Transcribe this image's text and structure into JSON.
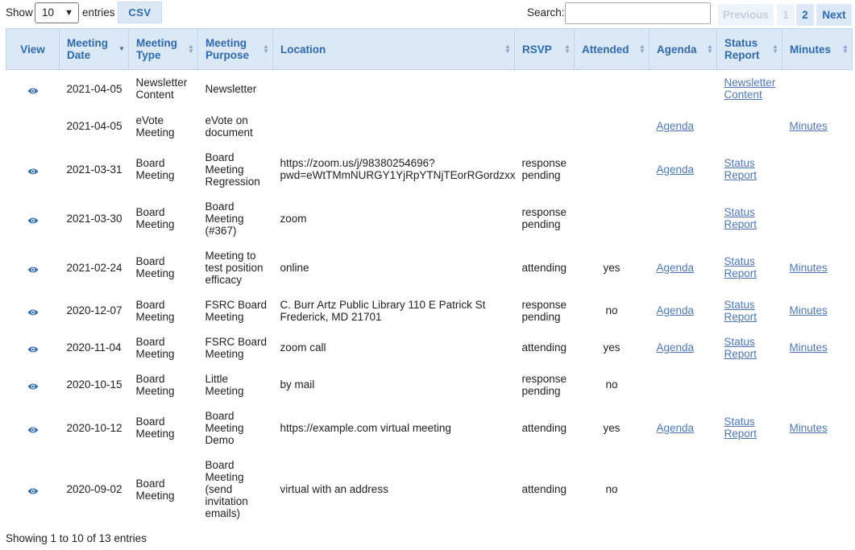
{
  "controls": {
    "show_label": "Show",
    "page_length": "10",
    "entries_label": "entries",
    "csv_label": "CSV",
    "search_label": "Search:",
    "search_value": ""
  },
  "pagination": {
    "previous": "Previous",
    "page1": "1",
    "page2": "2",
    "next": "Next"
  },
  "columns": {
    "view": "View",
    "meeting_date": [
      "Meeting",
      "Date"
    ],
    "meeting_type": [
      "Meeting",
      "Type"
    ],
    "meeting_purpose": [
      "Meeting",
      "Purpose"
    ],
    "location": "Location",
    "rsvp": "RSVP",
    "attended": "Attended",
    "agenda": "Agenda",
    "status_report": [
      "Status",
      "Report"
    ],
    "minutes": "Minutes"
  },
  "icons": {
    "view": "eye-icon",
    "sort": "sort-arrows-icon",
    "sort_desc": "sort-desc-icon",
    "dropdown": "chevron-down-icon"
  },
  "colors": {
    "accent": "#2e6ab0",
    "header_bg": "#dbe8f5",
    "link": "#4d78b5"
  },
  "rows": [
    {
      "has_view": true,
      "date": "2021-04-05",
      "type": [
        "Newsletter",
        "Content"
      ],
      "purpose": [
        "Newsletter"
      ],
      "location": [],
      "rsvp": [],
      "attended": "",
      "agenda": "",
      "status_report": [
        "Newsletter",
        "Content"
      ],
      "minutes": ""
    },
    {
      "has_view": false,
      "date": "2021-04-05",
      "type": [
        "eVote",
        "Meeting"
      ],
      "purpose": [
        "eVote on",
        "document"
      ],
      "location": [],
      "rsvp": [],
      "attended": "",
      "agenda": "Agenda",
      "status_report": [],
      "minutes": "Minutes"
    },
    {
      "has_view": true,
      "date": "2021-03-31",
      "type": [
        "Board",
        "Meeting"
      ],
      "purpose": [
        "Board",
        "Meeting",
        "Regression"
      ],
      "location": [
        "https://zoom.us/j/98380254696?",
        "pwd=eWtTMmNURGY1YjRpYTNjTEorRGordzxx"
      ],
      "rsvp": [
        "response",
        "pending"
      ],
      "attended": "",
      "agenda": "Agenda",
      "status_report": [
        "Status",
        "Report"
      ],
      "minutes": ""
    },
    {
      "has_view": true,
      "date": "2021-03-30",
      "type": [
        "Board",
        "Meeting"
      ],
      "purpose": [
        "Board",
        "Meeting",
        "(#367)"
      ],
      "location": [
        "zoom"
      ],
      "rsvp": [
        "response",
        "pending"
      ],
      "attended": "",
      "agenda": "",
      "status_report": [
        "Status",
        "Report"
      ],
      "minutes": ""
    },
    {
      "has_view": true,
      "date": "2021-02-24",
      "type": [
        "Board",
        "Meeting"
      ],
      "purpose": [
        "Meeting to",
        "test position",
        "efficacy"
      ],
      "location": [
        "online"
      ],
      "rsvp": [
        "attending"
      ],
      "attended": "yes",
      "agenda": "Agenda",
      "status_report": [
        "Status",
        "Report"
      ],
      "minutes": "Minutes"
    },
    {
      "has_view": true,
      "date": "2020-12-07",
      "type": [
        "Board",
        "Meeting"
      ],
      "purpose": [
        "FSRC Board",
        "Meeting"
      ],
      "location": [
        "C. Burr Artz Public Library 110 E Patrick St",
        "Frederick, MD 21701"
      ],
      "rsvp": [
        "response",
        "pending"
      ],
      "attended": "no",
      "agenda": "Agenda",
      "status_report": [
        "Status",
        "Report"
      ],
      "minutes": "Minutes"
    },
    {
      "has_view": true,
      "date": "2020-11-04",
      "type": [
        "Board",
        "Meeting"
      ],
      "purpose": [
        "FSRC Board",
        "Meeting"
      ],
      "location": [
        "zoom call"
      ],
      "rsvp": [
        "attending"
      ],
      "attended": "yes",
      "agenda": "Agenda",
      "status_report": [
        "Status",
        "Report"
      ],
      "minutes": "Minutes"
    },
    {
      "has_view": true,
      "date": "2020-10-15",
      "type": [
        "Board",
        "Meeting"
      ],
      "purpose": [
        "Little",
        "Meeting"
      ],
      "location": [
        "by mail"
      ],
      "rsvp": [
        "response",
        "pending"
      ],
      "attended": "no",
      "agenda": "",
      "status_report": [],
      "minutes": ""
    },
    {
      "has_view": true,
      "date": "2020-10-12",
      "type": [
        "Board",
        "Meeting"
      ],
      "purpose": [
        "Board",
        "Meeting",
        "Demo"
      ],
      "location": [
        "https://example.com virtual meeting"
      ],
      "rsvp": [
        "attending"
      ],
      "attended": "yes",
      "agenda": "Agenda",
      "status_report": [
        "Status",
        "Report"
      ],
      "minutes": "Minutes"
    },
    {
      "has_view": true,
      "date": "2020-09-02",
      "type": [
        "Board",
        "Meeting"
      ],
      "purpose": [
        "Board",
        "Meeting",
        "(send",
        "invitation",
        "emails)"
      ],
      "location": [
        "virtual with an address"
      ],
      "rsvp": [
        "attending"
      ],
      "attended": "no",
      "agenda": "",
      "status_report": [],
      "minutes": ""
    }
  ],
  "footer": {
    "info": "Showing 1 to 10 of 13 entries"
  }
}
